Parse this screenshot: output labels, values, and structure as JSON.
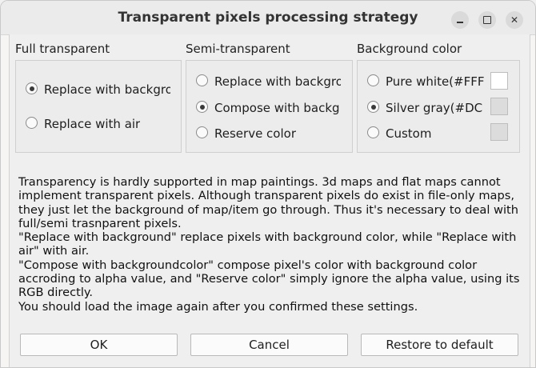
{
  "window": {
    "title": "Transparent pixels processing strategy"
  },
  "groups": {
    "full_transparent": {
      "title": "Full transparent",
      "options": [
        {
          "label": "Replace with backgro",
          "checked": true
        },
        {
          "label": "Replace with air",
          "checked": false
        }
      ]
    },
    "semi_transparent": {
      "title": "Semi-transparent",
      "options": [
        {
          "label": "Replace with backgro",
          "checked": false
        },
        {
          "label": "Compose with backg",
          "checked": true
        },
        {
          "label": "Reserve color",
          "checked": false
        }
      ]
    },
    "background_color": {
      "title": "Background color",
      "options": [
        {
          "label": "Pure white(#FFF",
          "checked": false,
          "swatch": "#ffffff"
        },
        {
          "label": "Silver gray(#DC",
          "checked": true,
          "swatch": "#dcdcdc"
        },
        {
          "label": "Custom",
          "checked": false,
          "swatch": "#dcdcdc"
        }
      ]
    }
  },
  "description": {
    "p1": "Transparency is hardly supported in map paintings. 3d maps and flat maps cannot implement transparent pixels. Although transparent pixels do exist in file-only maps, they just let the background of map/item go through. Thus it's necessary to deal with full/semi trasnparent pixels.",
    "p2": "\"Replace with background\" replace pixels with background color, while \"Replace with air\" with air.",
    "p3": "\"Compose with backgroundcolor\" compose pixel's color with background color accroding to alpha value, and \"Reserve color\" simply ignore the alpha value, using its RGB directly.",
    "p4": "You should load the image again after you confirmed these settings."
  },
  "buttons": {
    "ok": "OK",
    "cancel": "Cancel",
    "restore": "Restore to default"
  },
  "icons": {
    "minimize": "minimize-icon",
    "maximize": "maximize-icon",
    "close": "close-icon"
  }
}
